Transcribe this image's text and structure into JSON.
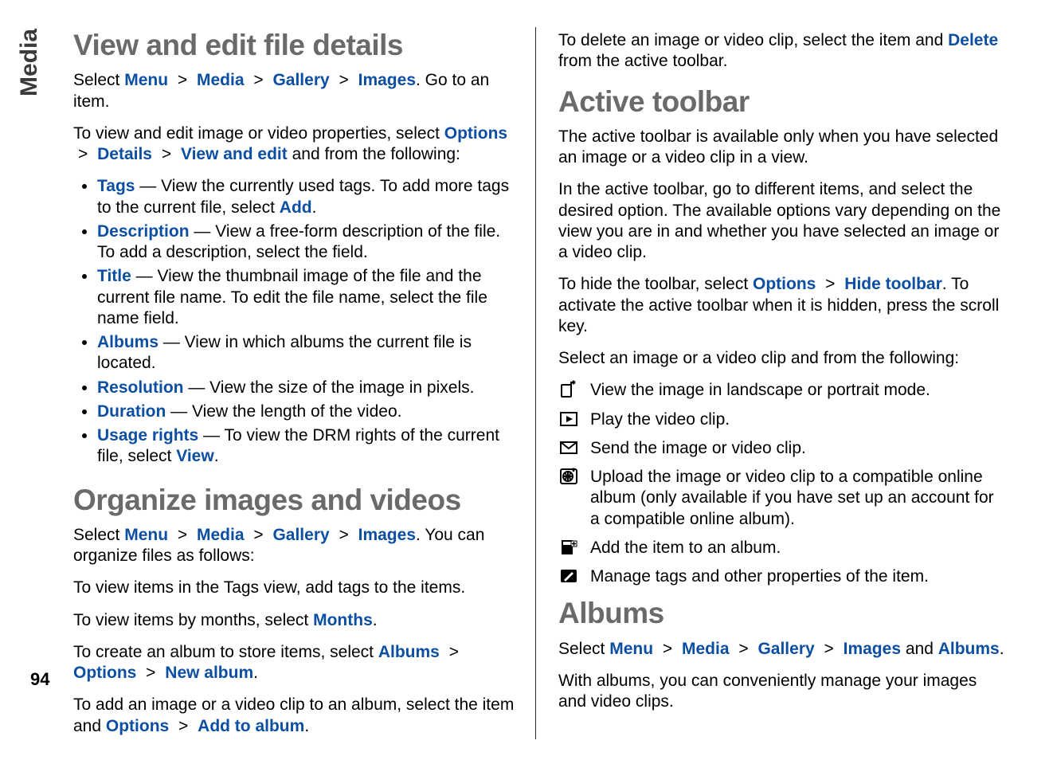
{
  "sideTab": "Media",
  "pageNumber": "94",
  "left": {
    "h1a": "View and edit file details",
    "p1_pre": "Select ",
    "nav1": [
      "Menu",
      "Media",
      "Gallery",
      "Images"
    ],
    "p1_post": ". Go to an item.",
    "p2_pre": "To view and edit image or video properties, select ",
    "nav2": [
      "Options",
      "Details",
      "View and edit"
    ],
    "p2_post": " and from the following:",
    "items": [
      {
        "term": "Tags",
        "txt1": "  — View the currently used tags. To add more tags to the current file, select ",
        "term2": "Add",
        "txt2": "."
      },
      {
        "term": "Description",
        "txt1": "  — View a free-form description of the file. To add a description, select the field.",
        "term2": "",
        "txt2": ""
      },
      {
        "term": "Title",
        "txt1": "  — View the thumbnail image of the file and the current file name. To edit the file name, select the file name field.",
        "term2": "",
        "txt2": ""
      },
      {
        "term": "Albums",
        "txt1": "  — View in which albums the current file is located.",
        "term2": "",
        "txt2": ""
      },
      {
        "term": "Resolution",
        "txt1": "  — View the size of the image in pixels.",
        "term2": "",
        "txt2": ""
      },
      {
        "term": "Duration",
        "txt1": "  — View the length of the video.",
        "term2": "",
        "txt2": ""
      },
      {
        "term": "Usage rights",
        "txt1": "  — To view the DRM rights of the current file, select ",
        "term2": "View",
        "txt2": "."
      }
    ],
    "h1b": "Organize images and videos",
    "p3_pre": "Select ",
    "nav3": [
      "Menu",
      "Media",
      "Gallery",
      "Images"
    ],
    "p3_post": ". You can organize files as follows:",
    "p4": "To view items in the Tags view, add tags to the items.",
    "p5_pre": "To view items by months, select ",
    "p5_term": "Months",
    "p5_post": ".",
    "p6_pre": "To create an album to store items, select ",
    "p6_term1": "Albums",
    "p6_mid": " > ",
    "p6_term2": "Options",
    "p6_mid2": " > ",
    "p6_term3": "New album",
    "p6_post": ".",
    "p7_pre": "To add an image or a video clip to an album, select the item and ",
    "p7_term1": "Options",
    "p7_mid": " > ",
    "p7_term2": "Add to album",
    "p7_post": "."
  },
  "right": {
    "p1_pre": "To delete an image or video clip, select the item and ",
    "p1_term": "Delete",
    "p1_post": " from the active toolbar.",
    "h1a": "Active toolbar",
    "p2": "The active toolbar is available only when you have selected an image or a video clip in a view.",
    "p3": "In the active toolbar, go to different items, and select the desired option. The available options vary depending on the view you are in and whether you have selected an image or a video clip.",
    "p4_pre": "To hide the toolbar, select ",
    "p4_term1": "Options",
    "p4_mid": " > ",
    "p4_term2": "Hide toolbar",
    "p4_post": ". To activate the active toolbar when it is hidden, press the scroll key.",
    "p5": "Select an image or a video clip and from the following:",
    "icons": [
      {
        "name": "rotate-icon",
        "text": "View the image in landscape or portrait mode."
      },
      {
        "name": "play-icon",
        "text": "Play the video clip."
      },
      {
        "name": "envelope-icon",
        "text": "Send the image or video clip."
      },
      {
        "name": "globe-upload-icon",
        "text": "Upload the image or video clip to a compatible online album (only available if you have set up an account for a compatible online album)."
      },
      {
        "name": "add-album-icon",
        "text": "Add the item to an album."
      },
      {
        "name": "edit-tag-icon",
        "text": "Manage tags and other properties of the item."
      }
    ],
    "h1b": "Albums",
    "p6_pre": "Select ",
    "nav6": [
      "Menu",
      "Media",
      "Gallery",
      "Images"
    ],
    "p6_mid": " and ",
    "p6_term": "Albums",
    "p6_post": ".",
    "p7": "With albums, you can conveniently manage your images and video clips."
  }
}
